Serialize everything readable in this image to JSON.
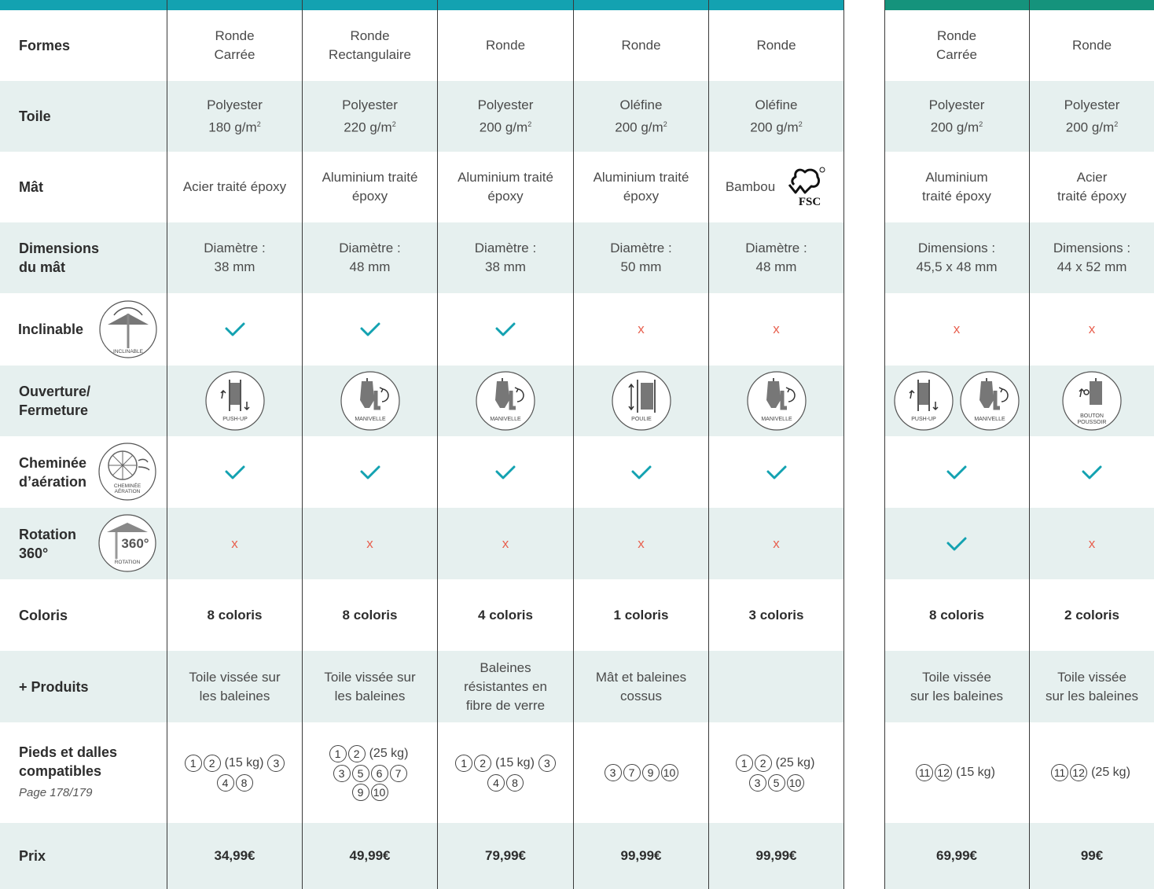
{
  "colors": {
    "header_left": "#13a2b1",
    "header_right": "#15937c",
    "row_shade": "#e6f0ef",
    "check": "#13a2b1",
    "cross": "#e8604f"
  },
  "rows": {
    "formes": {
      "label": "Formes",
      "cells": [
        "Ronde\nCarrée",
        "Ronde\nRectangulaire",
        "Ronde",
        "Ronde",
        "Ronde",
        "Ronde\nCarrée",
        "Ronde"
      ]
    },
    "toile": {
      "label": "Toile",
      "cells": [
        "Polyester\n180 g/m",
        "Polyester\n220 g/m",
        "Polyester\n200 g/m",
        "Oléfine\n200 g/m",
        "Oléfine\n200 g/m",
        "Polyester\n200 g/m",
        "Polyester\n200 g/m"
      ],
      "sup": "2"
    },
    "mat": {
      "label": "Mât",
      "cells": [
        "Acier traité époxy",
        "Aluminium traité\népoxy",
        "Aluminium traité\népoxy",
        "Aluminium traité\népoxy",
        "Bambou",
        "Aluminium\ntraité époxy",
        "Acier\ntraité époxy"
      ],
      "fsc_logo_text": "FSC"
    },
    "dimensions": {
      "label_line1": "Dimensions",
      "label_line2": "du mât",
      "cells": [
        "Diamètre :\n38 mm",
        "Diamètre :\n48 mm",
        "Diamètre :\n38 mm",
        "Diamètre :\n50 mm",
        "Diamètre :\n48 mm",
        "Dimensions :\n45,5 x 48 mm",
        "Dimensions :\n44 x 52 mm"
      ]
    },
    "inclinable": {
      "label": "Inclinable",
      "icon_caption": "INCLINABLE",
      "values": [
        "check",
        "check",
        "check",
        "cross",
        "cross",
        "cross",
        "cross"
      ],
      "cross_text": "x"
    },
    "ouverture": {
      "label_line1": "Ouverture/",
      "label_line2": "Fermeture",
      "pictos": [
        [
          "PUSH-UP"
        ],
        [
          "MANIVELLE"
        ],
        [
          "MANIVELLE"
        ],
        [
          "POULIE"
        ],
        [
          "MANIVELLE"
        ],
        [
          "PUSH-UP",
          "MANIVELLE"
        ],
        [
          "BOUTON POUSSOIR"
        ]
      ]
    },
    "cheminee": {
      "label_line1": "Cheminée",
      "label_line2": "d’aération",
      "icon_caption": "CHEMINÉE AÉRATION",
      "values": [
        "check",
        "check",
        "check",
        "check",
        "check",
        "check",
        "check"
      ]
    },
    "rotation": {
      "label_line1": "Rotation",
      "label_line2": "360°",
      "icon_value": "360°",
      "icon_caption": "ROTATION",
      "values": [
        "cross",
        "cross",
        "cross",
        "cross",
        "cross",
        "check",
        "cross"
      ]
    },
    "coloris": {
      "label": "Coloris",
      "cells": [
        "8 coloris",
        "8 coloris",
        "4 coloris",
        "1 coloris",
        "3 coloris",
        "8 coloris",
        "2 coloris"
      ]
    },
    "produits": {
      "label": "+ Produits",
      "cells": [
        "Toile vissée sur\nles baleines",
        "Toile vissée sur\nles baleines",
        "Baleines\nrésistantes en\nfibre de verre",
        "Mât et baleines\ncossus",
        "",
        "Toile vissée\nsur les baleines",
        "Toile vissée\nsur les baleines"
      ]
    },
    "pieds": {
      "label_line1": "Pieds et dalles",
      "label_line2": "compatibles",
      "sub": "Page 178/179",
      "cells": [
        [
          [
            "1",
            "2",
            "(15 kg)",
            "3"
          ],
          [
            "4",
            "8"
          ]
        ],
        [
          [
            "1",
            "2",
            "(25 kg)"
          ],
          [
            "3",
            "5",
            "6",
            "7"
          ],
          [
            "9",
            "10"
          ]
        ],
        [
          [
            "1",
            "2",
            "(15 kg)",
            "3"
          ],
          [
            "4",
            "8"
          ]
        ],
        [
          [
            "3",
            "7",
            "9",
            "10"
          ]
        ],
        [
          [
            "1",
            "2",
            "(25 kg)"
          ],
          [
            "3",
            "5",
            "10"
          ]
        ],
        [
          [
            "11",
            "12",
            "(15 kg)"
          ]
        ],
        [
          [
            "11",
            "12",
            "(25 kg)"
          ]
        ]
      ]
    },
    "prix": {
      "label": "Prix",
      "cells": [
        "34,99€",
        "49,99€",
        "79,99€",
        "99,99€",
        "99,99€",
        "69,99€",
        "99€"
      ]
    }
  }
}
